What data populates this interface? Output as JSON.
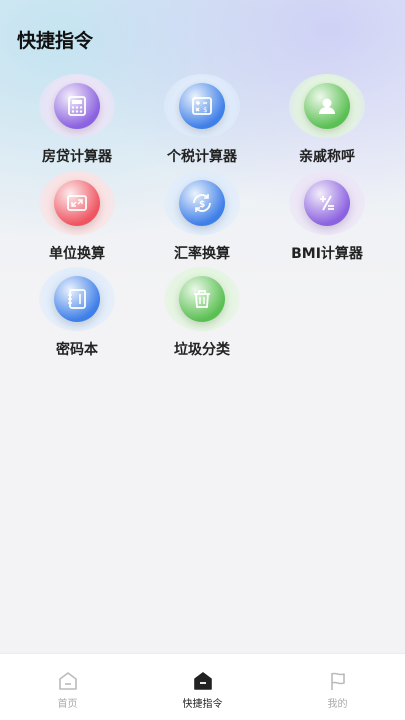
{
  "page": {
    "title": "快捷指令"
  },
  "tools": [
    {
      "label": "房贷计算器",
      "icon": "calculator-icon",
      "halo": "#ece4f7",
      "orb": "#8b62e0"
    },
    {
      "label": "个税计算器",
      "icon": "tax-calc-icon",
      "halo": "#e0ecfb",
      "orb": "#3f7fe8"
    },
    {
      "label": "亲戚称呼",
      "icon": "person-icon",
      "halo": "#e3f5df",
      "orb": "#5bc053"
    },
    {
      "label": "单位换算",
      "icon": "unit-convert-icon",
      "halo": "#fbe2e3",
      "orb": "#ef5561"
    },
    {
      "label": "汇率换算",
      "icon": "currency-exchange-icon",
      "halo": "#e0ecfb",
      "orb": "#3f7fe8"
    },
    {
      "label": "BMI计算器",
      "icon": "bmi-icon",
      "halo": "#ece4f7",
      "orb": "#8b62e0"
    },
    {
      "label": "密码本",
      "icon": "password-book-icon",
      "halo": "#e0ecfb",
      "orb": "#3f7fe8"
    },
    {
      "label": "垃圾分类",
      "icon": "trash-icon",
      "halo": "#e3f5df",
      "orb": "#5bc053"
    }
  ],
  "tabbar": {
    "items": [
      {
        "label": "首页",
        "icon": "home-icon",
        "active": false
      },
      {
        "label": "快捷指令",
        "icon": "shortcut-icon",
        "active": true
      },
      {
        "label": "我的",
        "icon": "flag-icon",
        "active": false
      }
    ]
  }
}
